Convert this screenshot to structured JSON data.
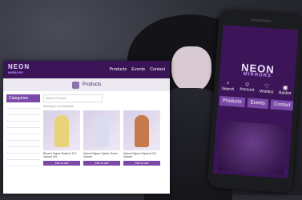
{
  "laptop": {
    "logo": "NEON",
    "logo_sub": "MIRRORS",
    "nav": [
      "Products",
      "Events",
      "Contact"
    ],
    "banner_title": "Products",
    "sidebar_title": "Categories",
    "search_placeholder": "Search Products",
    "sort_label": "Showing 1-9 of 35 items",
    "products": [
      {
        "name": "Bleach Figure Rukia & S.S. Variant Ver.",
        "price": "",
        "button": "Add to cart",
        "color": "#e8d37a"
      },
      {
        "name": "Marvel Figure Spider-Gwen Variant",
        "price": "",
        "button": "Add to cart",
        "color": "#dcdcf0"
      },
      {
        "name": "Marvel Figure Squirrel Girl Variant",
        "price": "",
        "button": "Add to cart",
        "color": "#c77b4d"
      }
    ]
  },
  "phone": {
    "logo": "NEON",
    "logo_sub": "MIRRORS",
    "icons": [
      {
        "icon": "search-icon",
        "label": "Search"
      },
      {
        "icon": "account-icon",
        "label": "Account"
      },
      {
        "icon": "wishlist-icon",
        "label": "Wishlist"
      },
      {
        "icon": "basket-icon",
        "label": "Basket"
      }
    ],
    "tabs": [
      "Products",
      "Events",
      "Contact"
    ]
  }
}
